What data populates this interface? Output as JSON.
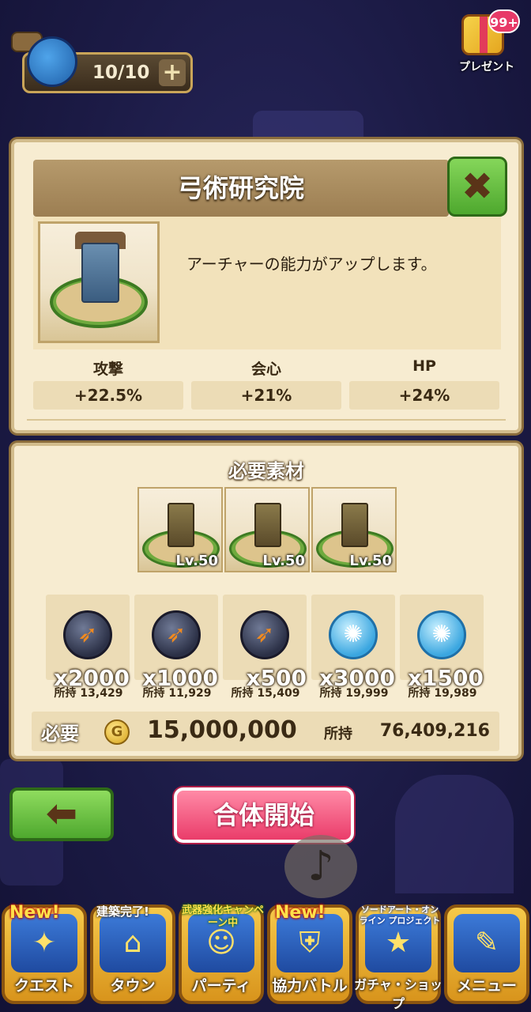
{
  "topbar": {
    "stamina": "10/10",
    "stamina_plus": "+",
    "present_badge": "99+",
    "present_label": "プレゼント"
  },
  "facility": {
    "name": "弓術研究院",
    "close_icon": "✖",
    "description": "アーチャーの能力がアップします。",
    "stats": [
      {
        "label": "攻撃",
        "value": "+22.5%"
      },
      {
        "label": "会心",
        "value": "+21%"
      },
      {
        "label": "HP",
        "value": "+24%"
      }
    ]
  },
  "materials": {
    "title": "必要素材",
    "facilities": [
      {
        "level": "Lv.50"
      },
      {
        "level": "Lv.50"
      },
      {
        "level": "Lv.50"
      }
    ],
    "items": [
      {
        "icon": "dark-bow-orb-icon",
        "qty": "x2000",
        "owned": "所持 13,429"
      },
      {
        "icon": "dark-bow-gem-icon",
        "qty": "x1000",
        "owned": "所持 11,929"
      },
      {
        "icon": "dark-bow-star-icon",
        "qty": "x500",
        "owned": "所持 15,409"
      },
      {
        "icon": "blue-orb-icon",
        "qty": "x3000",
        "owned": "所持 19,999"
      },
      {
        "icon": "blue-gem-icon",
        "qty": "x1500",
        "owned": "所持 19,989"
      }
    ],
    "cost_label": "必要",
    "coin_symbol": "G",
    "cost_value": "15,000,000",
    "own_label": "所持",
    "own_value": "76,409,216"
  },
  "actions": {
    "back_icon": "⬅",
    "start_label": "合体開始",
    "music_icon": "♪"
  },
  "nav": {
    "items": [
      {
        "label": "クエスト",
        "badge": "New!",
        "icon": "✦"
      },
      {
        "label": "タウン",
        "badge": "建築完了!",
        "icon": "⌂"
      },
      {
        "label": "パーティ",
        "badge": "武器強化キャンペーン中",
        "icon": "☺"
      },
      {
        "label": "協力バトル",
        "badge": "New!",
        "icon": "⛨"
      },
      {
        "label": "ガチャ・ショップ",
        "badge": "ソードアート・オンライン プロジェクト",
        "icon": "★"
      },
      {
        "label": "メニュー",
        "badge": "",
        "icon": "✎"
      }
    ]
  }
}
